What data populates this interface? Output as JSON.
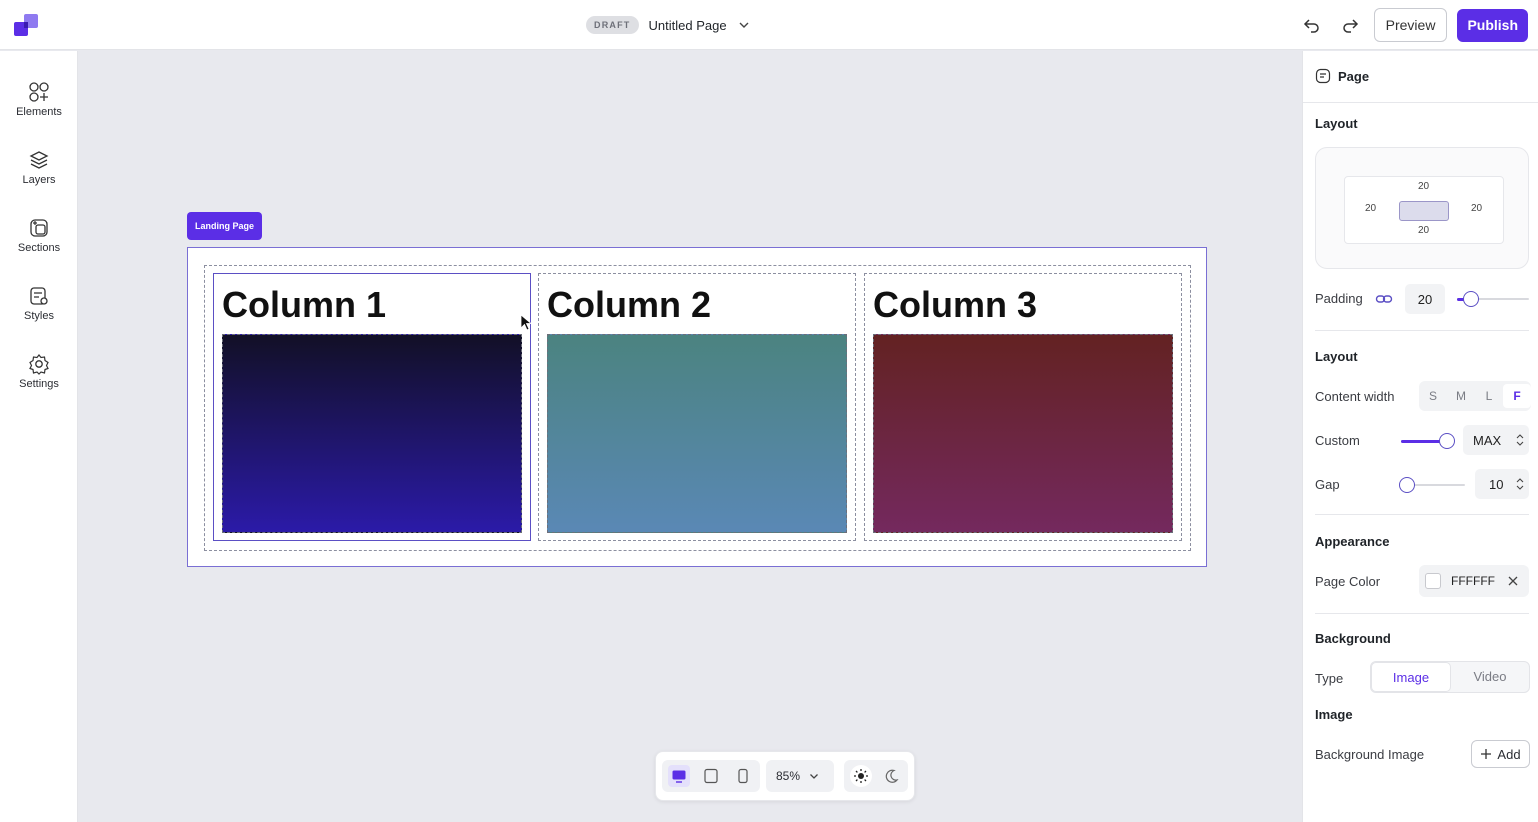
{
  "topbar": {
    "status_badge": "DRAFT",
    "page_title": "Untitled Page",
    "preview_label": "Preview",
    "publish_label": "Publish"
  },
  "leftrail": {
    "items": [
      {
        "label": "Elements",
        "icon": "elements-icon"
      },
      {
        "label": "Layers",
        "icon": "layers-icon"
      },
      {
        "label": "Sections",
        "icon": "sections-icon"
      },
      {
        "label": "Styles",
        "icon": "styles-icon"
      },
      {
        "label": "Settings",
        "icon": "gear-icon"
      }
    ]
  },
  "canvas": {
    "landing_tag": "Landing Page",
    "columns": [
      {
        "title": "Column 1",
        "gradient": [
          "#121026",
          "#2b1aa8"
        ]
      },
      {
        "title": "Column 2",
        "gradient": [
          "#4b8380",
          "#5a88b5"
        ]
      },
      {
        "title": "Column 3",
        "gradient": [
          "#632222",
          "#74295e"
        ]
      }
    ]
  },
  "bottom_toolbar": {
    "zoom": "85%",
    "devices": [
      "desktop-icon",
      "tablet-icon",
      "mobile-icon"
    ],
    "themes": [
      "sun-icon",
      "moon-icon"
    ]
  },
  "rightpanel": {
    "header": "Page",
    "layout_title": "Layout",
    "spacing": {
      "top": "20",
      "left": "20",
      "right": "20",
      "bottom": "20"
    },
    "padding_label": "Padding",
    "padding_value": "20",
    "padding_slider_fraction": 0.2,
    "layout2_title": "Layout",
    "content_width_label": "Content width",
    "content_width_options": [
      "S",
      "M",
      "L",
      "F"
    ],
    "content_width_selected": "F",
    "custom_label": "Custom",
    "custom_value": "MAX",
    "custom_slider_fraction": 1.0,
    "gap_label": "Gap",
    "gap_value": "10",
    "gap_slider_fraction": 0.1,
    "appearance_title": "Appearance",
    "page_color_label": "Page Color",
    "page_color_value": "FFFFFF",
    "background_title": "Background",
    "type_label": "Type",
    "type_options": [
      "Image",
      "Video"
    ],
    "type_selected": "Image",
    "image_title": "Image",
    "background_image_label": "Background Image",
    "add_label": "Add"
  },
  "colors": {
    "accent": "#5b2ee6",
    "canvas_bg": "#e8e9ee"
  }
}
